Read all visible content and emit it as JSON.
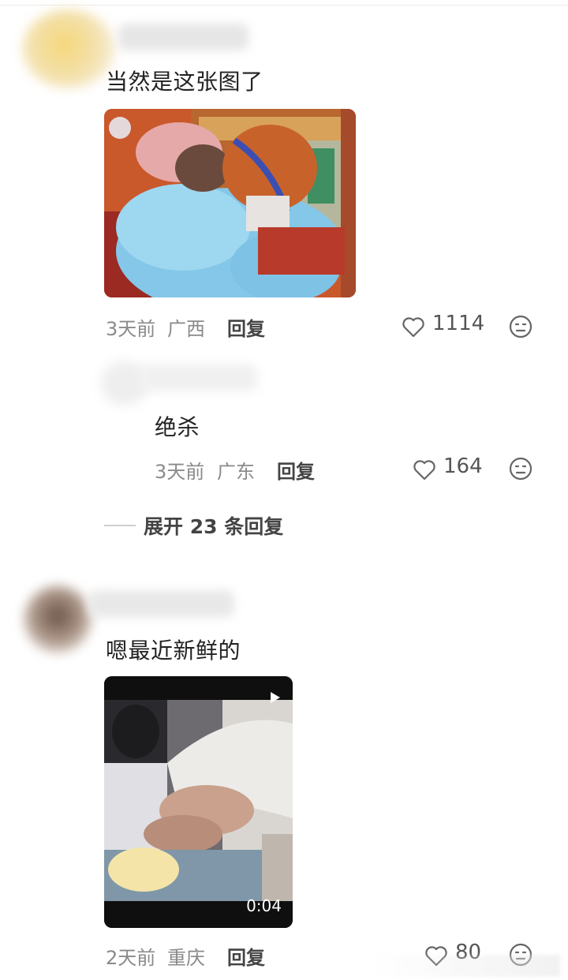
{
  "comments": [
    {
      "text": "当然是这张图了",
      "time": "3天前",
      "location": "广西",
      "reply_label": "回复",
      "likes": "1114"
    },
    {
      "text": "嗯最近新鲜的",
      "time": "2天前",
      "location": "重庆",
      "reply_label": "回复",
      "likes": "80",
      "video_duration": "0:04"
    }
  ],
  "reply": {
    "text": "绝杀",
    "time": "3天前",
    "location": "广东",
    "reply_label": "回复",
    "likes": "164"
  },
  "expand_label": "展开 23 条回复",
  "icons": {
    "like": "heart-icon",
    "emoji": "emoji-face-icon",
    "play": "play-icon"
  },
  "colors": {
    "text": "#222222",
    "meta": "#8a8a8a",
    "icon": "#666666"
  }
}
